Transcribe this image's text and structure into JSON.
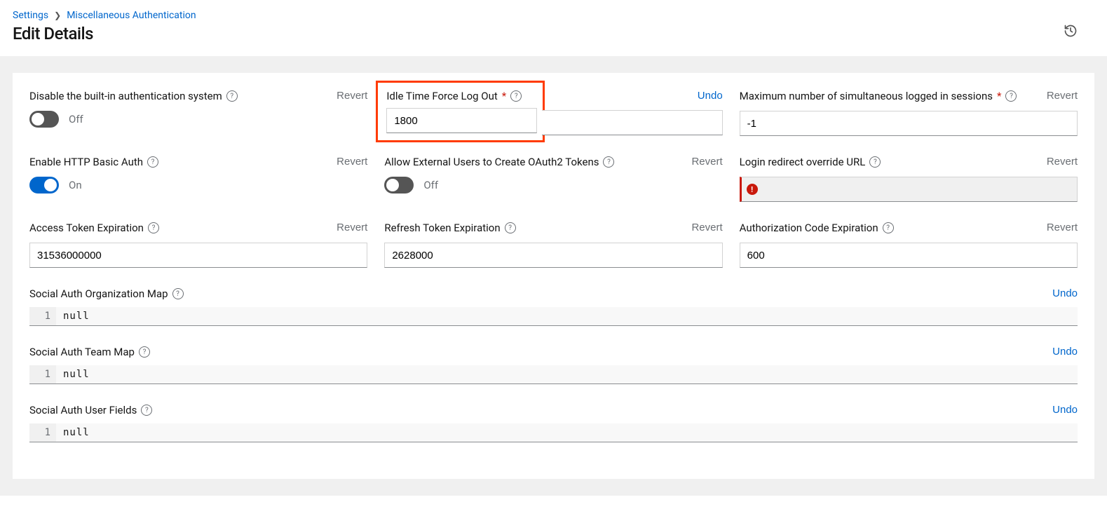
{
  "breadcrumb": {
    "settings": "Settings",
    "misc_auth": "Miscellaneous Authentication"
  },
  "page_title": "Edit Details",
  "labels": {
    "disable_builtin": "Disable the built-in authentication system",
    "idle_timeout": "Idle Time Force Log Out",
    "max_sessions": "Maximum number of simultaneous logged in sessions",
    "http_basic": "Enable HTTP Basic Auth",
    "allow_ext_oauth": "Allow External Users to Create OAuth2 Tokens",
    "login_redirect": "Login redirect override URL",
    "access_token_exp": "Access Token Expiration",
    "refresh_token_exp": "Refresh Token Expiration",
    "auth_code_exp": "Authorization Code Expiration",
    "social_org_map": "Social Auth Organization Map",
    "social_team_map": "Social Auth Team Map",
    "social_user_fields": "Social Auth User Fields"
  },
  "actions": {
    "revert": "Revert",
    "undo": "Undo"
  },
  "toggle": {
    "on": "On",
    "off": "Off"
  },
  "values": {
    "idle_timeout": "1800",
    "max_sessions": "-1",
    "login_redirect": "",
    "access_token_exp": "31536000000",
    "refresh_token_exp": "2628000",
    "auth_code_exp": "600",
    "social_org_map": "null",
    "social_team_map": "null",
    "social_user_fields": "null"
  },
  "code_gutter": "1"
}
